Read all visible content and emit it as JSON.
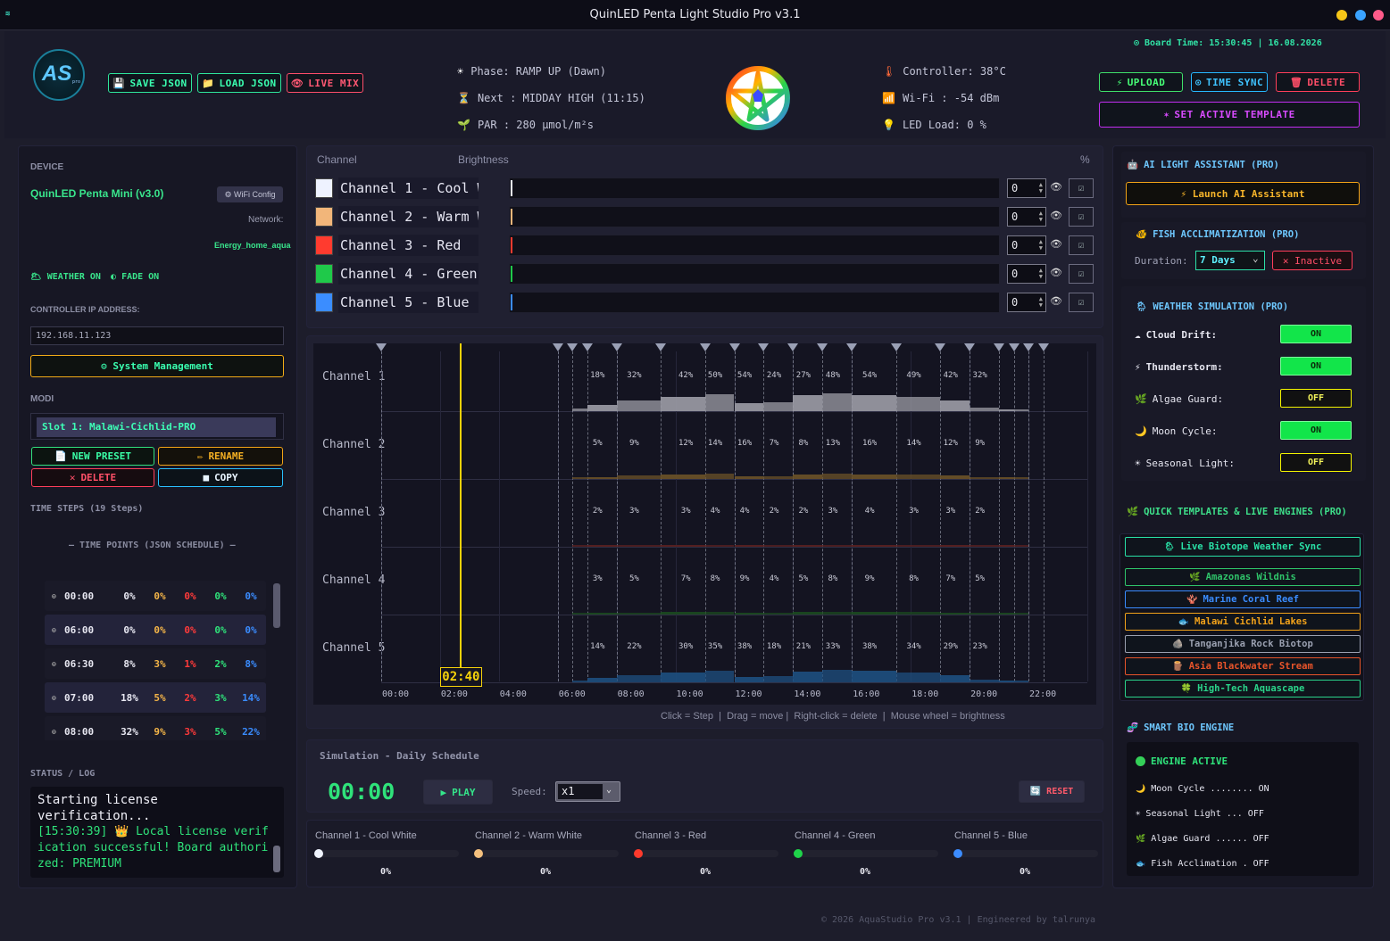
{
  "window": {
    "title": "QuinLED Penta Light Studio Pro v3.1"
  },
  "header": {
    "board_time": "⊙ Board Time: 15:30:45 | 16.08.2026",
    "save_json": "SAVE JSON",
    "load_json": "LOAD JSON",
    "live_mix": "LIVE MIX",
    "phase": "Phase: RAMP UP (Dawn)",
    "next": "Next : MIDDAY HIGH (11:15)",
    "par": "PAR  : 280 µmol/m²s",
    "controller": "Controller: 38°C",
    "wifi": "Wi-Fi : -54 dBm",
    "led_load": "LED Load: 0 %",
    "upload": "UPLOAD",
    "time_sync": "TIME SYNC",
    "delete": "DELETE",
    "set_active_template": "SET ACTIVE TEMPLATE",
    "logo_text": "AS",
    "logo_sub": "pro"
  },
  "left": {
    "device_label": "DEVICE",
    "device_name": "QuinLED Penta Mini (v3.0)",
    "wifi_config": "⚙ WiFi Config",
    "network_label": "Network:",
    "network_name": "Energy_home_aqua",
    "weather_on": "WEATHER ON",
    "fade_on": "FADE ON",
    "ip_label": "CONTROLLER IP ADDRESS:",
    "ip_value": "192.168.11.123",
    "system_management": "⚙ System Management",
    "modi_label": "MODI",
    "slot": "Slot 1: Malawi-Cichlid-PRO",
    "new_preset": "NEW PRESET",
    "rename": "RENAME",
    "delete": "DELETE",
    "copy": "COPY",
    "time_steps": "TIME STEPS (19 Steps)",
    "time_points": "— TIME POINTS (JSON SCHEDULE) —",
    "steps": [
      {
        "time": "00:00",
        "c1": "0%",
        "c2": "0%",
        "c3": "0%",
        "c4": "0%",
        "c5": "0%"
      },
      {
        "time": "06:00",
        "c1": "0%",
        "c2": "0%",
        "c3": "0%",
        "c4": "0%",
        "c5": "0%"
      },
      {
        "time": "06:30",
        "c1": "8%",
        "c2": "3%",
        "c3": "1%",
        "c4": "2%",
        "c5": "8%"
      },
      {
        "time": "07:00",
        "c1": "18%",
        "c2": "5%",
        "c3": "2%",
        "c4": "3%",
        "c5": "14%"
      },
      {
        "time": "08:00",
        "c1": "32%",
        "c2": "9%",
        "c3": "3%",
        "c4": "5%",
        "c5": "22%"
      }
    ],
    "status_label": "STATUS / LOG",
    "log_line1": "Starting license verification...",
    "log_line2": "[15:30:39] 👑 Local license verification successful! Board authorized: PREMIUM"
  },
  "channels": {
    "col_channel": "Channel",
    "col_brightness": "Brightness",
    "col_pct": "%",
    "list": [
      {
        "name": "Channel 1 - Cool White",
        "value": "0",
        "color": "#eef2ff"
      },
      {
        "name": "Channel 2 - Warm White",
        "value": "0",
        "color": "#f2b67a"
      },
      {
        "name": "Channel 3 - Red",
        "value": "0",
        "color": "#ff3b2f"
      },
      {
        "name": "Channel 4 - Green",
        "value": "0",
        "color": "#1fc94a"
      },
      {
        "name": "Channel 5 - Blue",
        "value": "0",
        "color": "#3b8dff"
      }
    ]
  },
  "timeline": {
    "rows": [
      "Channel 1",
      "Channel 2",
      "Channel 3",
      "Channel 4",
      "Channel 5"
    ],
    "ticks": [
      "00:00",
      "02:00",
      "04:00",
      "06:00",
      "08:00",
      "10:00",
      "12:00",
      "14:00",
      "16:00",
      "18:00",
      "20:00",
      "22:00"
    ],
    "cursor": "02:40",
    "hint": "Click = Step  |  Drag = move |  Right-click = delete  |  Mouse wheel = brightness",
    "markers_h": [
      0,
      6,
      6.5,
      7,
      8,
      9.5,
      11,
      12,
      13,
      14,
      15,
      16,
      17.5,
      19,
      20,
      21,
      21.5,
      22,
      22.5
    ],
    "labels": {
      "c1": [
        [
          "7",
          "18%"
        ],
        [
          "8.25",
          "32%"
        ],
        [
          "10",
          "42%"
        ],
        [
          "11",
          "50%"
        ],
        [
          "12",
          "54%"
        ],
        [
          "13",
          "24%"
        ],
        [
          "14",
          "27%"
        ],
        [
          "15",
          "48%"
        ],
        [
          "16.25",
          "54%"
        ],
        [
          "17.75",
          "49%"
        ],
        [
          "19",
          "42%"
        ],
        [
          "20",
          "32%"
        ]
      ],
      "c2": [
        [
          "7",
          "5%"
        ],
        [
          "8.25",
          "9%"
        ],
        [
          "10",
          "12%"
        ],
        [
          "11",
          "14%"
        ],
        [
          "12",
          "16%"
        ],
        [
          "13",
          "7%"
        ],
        [
          "14",
          "8%"
        ],
        [
          "15",
          "13%"
        ],
        [
          "16.25",
          "16%"
        ],
        [
          "17.75",
          "14%"
        ],
        [
          "19",
          "12%"
        ],
        [
          "20",
          "9%"
        ]
      ],
      "c3": [
        [
          "7",
          "2%"
        ],
        [
          "8.25",
          "3%"
        ],
        [
          "10",
          "3%"
        ],
        [
          "11",
          "4%"
        ],
        [
          "12",
          "4%"
        ],
        [
          "13",
          "2%"
        ],
        [
          "14",
          "2%"
        ],
        [
          "15",
          "3%"
        ],
        [
          "16.25",
          "4%"
        ],
        [
          "17.75",
          "3%"
        ],
        [
          "19",
          "3%"
        ],
        [
          "20",
          "2%"
        ]
      ],
      "c4": [
        [
          "7",
          "3%"
        ],
        [
          "8.25",
          "5%"
        ],
        [
          "10",
          "7%"
        ],
        [
          "11",
          "8%"
        ],
        [
          "12",
          "9%"
        ],
        [
          "13",
          "4%"
        ],
        [
          "14",
          "5%"
        ],
        [
          "15",
          "8%"
        ],
        [
          "16.25",
          "9%"
        ],
        [
          "17.75",
          "8%"
        ],
        [
          "19",
          "7%"
        ],
        [
          "20",
          "5%"
        ]
      ],
      "c5": [
        [
          "7",
          "14%"
        ],
        [
          "8.25",
          "22%"
        ],
        [
          "10",
          "30%"
        ],
        [
          "11",
          "35%"
        ],
        [
          "12",
          "38%"
        ],
        [
          "13",
          "18%"
        ],
        [
          "14",
          "21%"
        ],
        [
          "15",
          "33%"
        ],
        [
          "16.25",
          "38%"
        ],
        [
          "17.75",
          "34%"
        ],
        [
          "19",
          "29%"
        ],
        [
          "20",
          "23%"
        ]
      ]
    }
  },
  "simulation": {
    "title": "Simulation - Daily Schedule",
    "clock": "00:00",
    "play": "PLAY",
    "speed_label": "Speed:",
    "speed_value": "x1",
    "reset": "RESET"
  },
  "live": [
    {
      "name": "Channel 1 - Cool White",
      "pct": "0%",
      "color": "#f0f4ff"
    },
    {
      "name": "Channel 2 - Warm White",
      "pct": "0%",
      "color": "#f4c07e"
    },
    {
      "name": "Channel 3 - Red",
      "pct": "0%",
      "color": "#ff3a2c"
    },
    {
      "name": "Channel 4 - Green",
      "pct": "0%",
      "color": "#1fd34a"
    },
    {
      "name": "Channel 5 - Blue",
      "pct": "0%",
      "color": "#3c8cff"
    }
  ],
  "right": {
    "ai_title": "AI LIGHT ASSISTANT (PRO)",
    "launch_ai": "⚡ Launch AI Assistant",
    "fish_title": "FISH ACCLIMATIZATION (PRO)",
    "duration_label": "Duration:",
    "duration_value": "7 Days",
    "inactive": "✕ Inactive",
    "weather_title": "WEATHER SIMULATION (PRO)",
    "toggles": [
      {
        "icon": "☁",
        "label": "Cloud Drift:",
        "state": "ON"
      },
      {
        "icon": "⚡",
        "label": "Thunderstorm:",
        "state": "ON"
      },
      {
        "icon": "🌿",
        "label": "Algae Guard:",
        "state": "OFF"
      },
      {
        "icon": "🌙",
        "label": "Moon Cycle:",
        "state": "ON"
      },
      {
        "icon": "☀",
        "label": "Seasonal Light:",
        "state": "OFF"
      }
    ],
    "quick_title": "QUICK TEMPLATES & LIVE ENGINES (PRO)",
    "templates": [
      {
        "label": "Live Biotope Weather Sync",
        "color": "#29e0a6"
      },
      {
        "label": "Amazonas Wildnis",
        "color": "#2fc46a"
      },
      {
        "label": "Marine Coral Reef",
        "color": "#3a8cff"
      },
      {
        "label": "Malawi Cichlid Lakes",
        "color": "#f2a21a"
      },
      {
        "label": "Tanganjika Rock Biotop",
        "color": "#9aa0b0"
      },
      {
        "label": "Asia Blackwater Stream",
        "color": "#e8542a"
      },
      {
        "label": "High-Tech Aquascape",
        "color": "#2ad38a"
      }
    ],
    "bio_title": "SMART BIO ENGINE",
    "engine_active": "ENGINE ACTIVE",
    "bio_lines": [
      "Moon Cycle ........ ON",
      "Seasonal Light ... OFF",
      "Algae Guard ...... OFF",
      "Fish Acclimation . OFF"
    ]
  },
  "footer": "© 2026 AquaStudio Pro v3.1 | Engineered by talrunya"
}
